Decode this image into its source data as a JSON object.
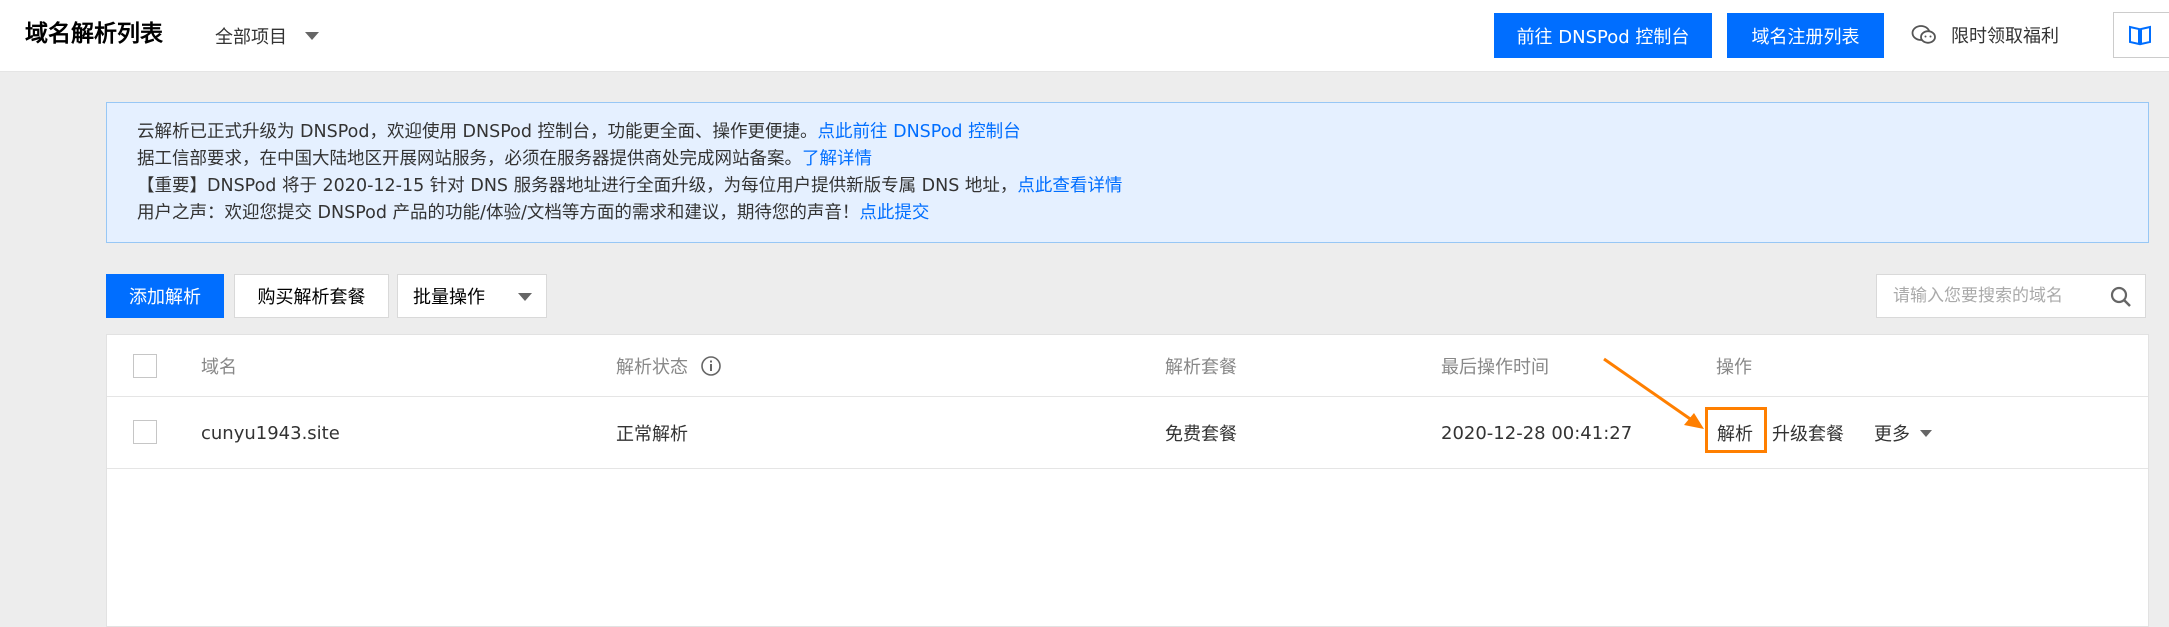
{
  "header": {
    "title": "域名解析列表",
    "project_select": "全部项目",
    "go_dnspod_button": "前往 DNSPod 控制台",
    "domain_register_button": "域名注册列表",
    "benefit_link": "限时领取福利"
  },
  "notice": {
    "line1_text": "云解析已正式升级为 DNSPod，欢迎使用 DNSPod 控制台，功能更全面、操作更便捷。",
    "line1_link": "点此前往 DNSPod 控制台",
    "line2_text": "据工信部要求，在中国大陆地区开展网站服务，必须在服务器提供商处完成网站备案。",
    "line2_link": "了解详情",
    "line3_text": "【重要】DNSPod 将于 2020-12-15 针对 DNS 服务器地址进行全面升级，为每位用户提供新版专属 DNS 地址，",
    "line3_link": "点此查看详情",
    "line4_text": "用户之声：欢迎您提交 DNSPod 产品的功能/体验/文档等方面的需求和建议，期待您的声音！",
    "line4_link": "点此提交"
  },
  "toolbar": {
    "add_button": "添加解析",
    "buy_button": "购买解析套餐",
    "batch_select": "批量操作",
    "search_placeholder": "请输入您要搜索的域名"
  },
  "table": {
    "columns": [
      "域名",
      "解析状态",
      "解析套餐",
      "最后操作时间",
      "操作"
    ],
    "rows": [
      {
        "domain": "cunyu1943.site",
        "status": "正常解析",
        "package": "免费套餐",
        "last_time": "2020-12-28 00:41:27",
        "action_resolve": "解析",
        "action_upgrade": "升级套餐",
        "action_more": "更多"
      }
    ]
  },
  "colors": {
    "primary": "#006eff",
    "success": "#0abf5b",
    "annotation": "#ff7f00"
  },
  "icons": [
    "caret-down-icon",
    "wechat-icon",
    "book-icon",
    "info-icon",
    "search-icon",
    "arrow-annotation"
  ]
}
